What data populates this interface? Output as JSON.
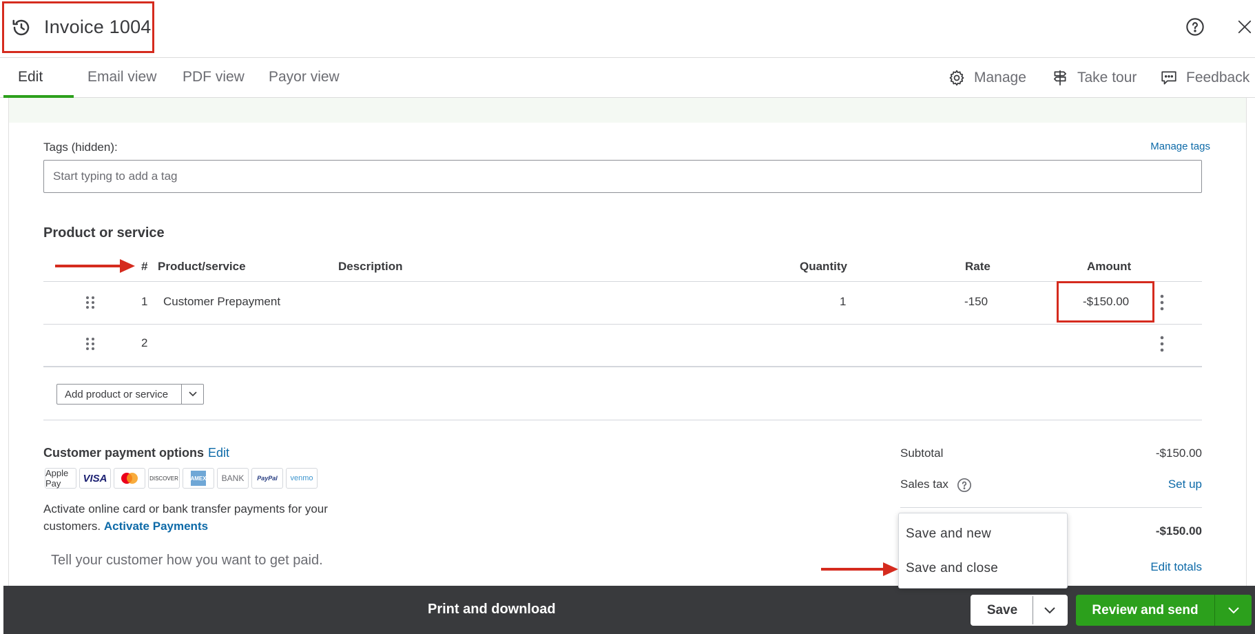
{
  "header": {
    "title": "Invoice 1004",
    "history_icon": "history-icon",
    "help_icon": "help-icon",
    "close_icon": "close-icon"
  },
  "tabs": [
    {
      "label": "Edit",
      "active": true
    },
    {
      "label": "Email view",
      "active": false
    },
    {
      "label": "PDF view",
      "active": false
    },
    {
      "label": "Payor view",
      "active": false
    }
  ],
  "toolbar": {
    "manage": "Manage",
    "take_tour": "Take tour",
    "feedback": "Feedback"
  },
  "tags": {
    "label": "Tags (hidden):",
    "manage_link": "Manage tags",
    "placeholder": "Start typing to add a tag"
  },
  "products": {
    "section_title": "Product or service",
    "columns": {
      "num": "#",
      "product": "Product/service",
      "description": "Description",
      "quantity": "Quantity",
      "rate": "Rate",
      "amount": "Amount"
    },
    "rows": [
      {
        "num": "1",
        "product": "Customer Prepayment",
        "description": "",
        "quantity": "1",
        "rate": "-150",
        "amount": "-$150.00"
      },
      {
        "num": "2",
        "product": "",
        "description": "",
        "quantity": "",
        "rate": "",
        "amount": ""
      }
    ],
    "add_button": "Add product or service"
  },
  "payment_options": {
    "title": "Customer payment options",
    "edit": "Edit",
    "methods": [
      "Apple Pay",
      "VISA",
      "Mastercard",
      "DISCOVER",
      "AMEX",
      "BANK",
      "PayPal",
      "venmo"
    ],
    "activate_text": "Activate online card or bank transfer payments for your customers.",
    "activate_link": "Activate Payments",
    "tell_placeholder": "Tell your customer how you want to get paid."
  },
  "totals": {
    "subtotal_label": "Subtotal",
    "subtotal_value": "-$150.00",
    "sales_tax_label": "Sales tax",
    "sales_tax_action": "Set up",
    "total_value": "-$150.00",
    "edit_totals": "Edit totals"
  },
  "save_menu": {
    "items": [
      "Save and new",
      "Save and close"
    ]
  },
  "footer": {
    "print": "Print and download",
    "save": "Save",
    "review_send": "Review and send"
  },
  "colors": {
    "accent_green": "#2ca01c",
    "link_blue": "#0d6aa8",
    "annotation_red": "#d52b1e",
    "footer_bg": "#393a3d"
  }
}
